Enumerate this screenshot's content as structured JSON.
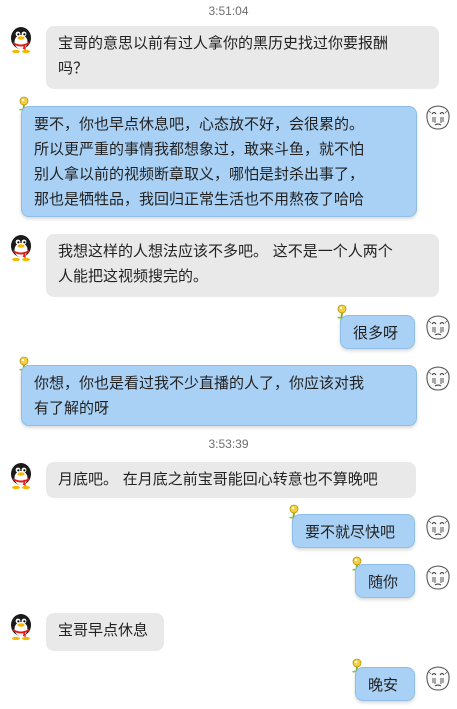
{
  "timestamps": [
    "3:51:04",
    "3:53:39"
  ],
  "messages": [
    {
      "side": "left",
      "lines": [
        "宝哥的意思以前有过人拿你的黑历史找过你要报酬",
        "吗？"
      ]
    },
    {
      "side": "right",
      "lines": [
        "要不，你也早点休息吧，心态放不好，会很累的。",
        "所以更严重的事情我都想象过，敢来斗鱼，就不怕",
        "别人拿以前的视频断章取义，哪怕是封杀出事了，",
        "那也是牺牲品，我回归正常生活也不用熬夜了哈哈"
      ]
    },
    {
      "side": "left",
      "lines": [
        "我想这样的人想法应该不多吧。 这不是一个人两个",
        "人能把这视频搜完的。"
      ]
    },
    {
      "side": "right",
      "lines": [
        "很多呀"
      ]
    },
    {
      "side": "right",
      "lines": [
        "你想，你也是看过我不少直播的人了，你应该对我",
        "有了解的呀"
      ]
    },
    {
      "side": "left",
      "lines": [
        "月底吧。  在月底之前宝哥能回心转意也不算晚吧"
      ]
    },
    {
      "side": "right",
      "lines": [
        "要不就尽快吧"
      ]
    },
    {
      "side": "right",
      "lines": [
        "随你"
      ]
    },
    {
      "side": "left",
      "lines": [
        "宝哥早点休息"
      ]
    },
    {
      "side": "right",
      "lines": [
        "晚安"
      ]
    }
  ],
  "icons": {
    "left_avatar": "qq-penguin-icon",
    "right_avatar": "sketch-face-icon",
    "bubble_pin": "pin-icon"
  },
  "colors": {
    "left_bubble": "#e9e9e9",
    "right_bubble": "#a9d1f5",
    "timestamp": "#6e6e6e"
  }
}
